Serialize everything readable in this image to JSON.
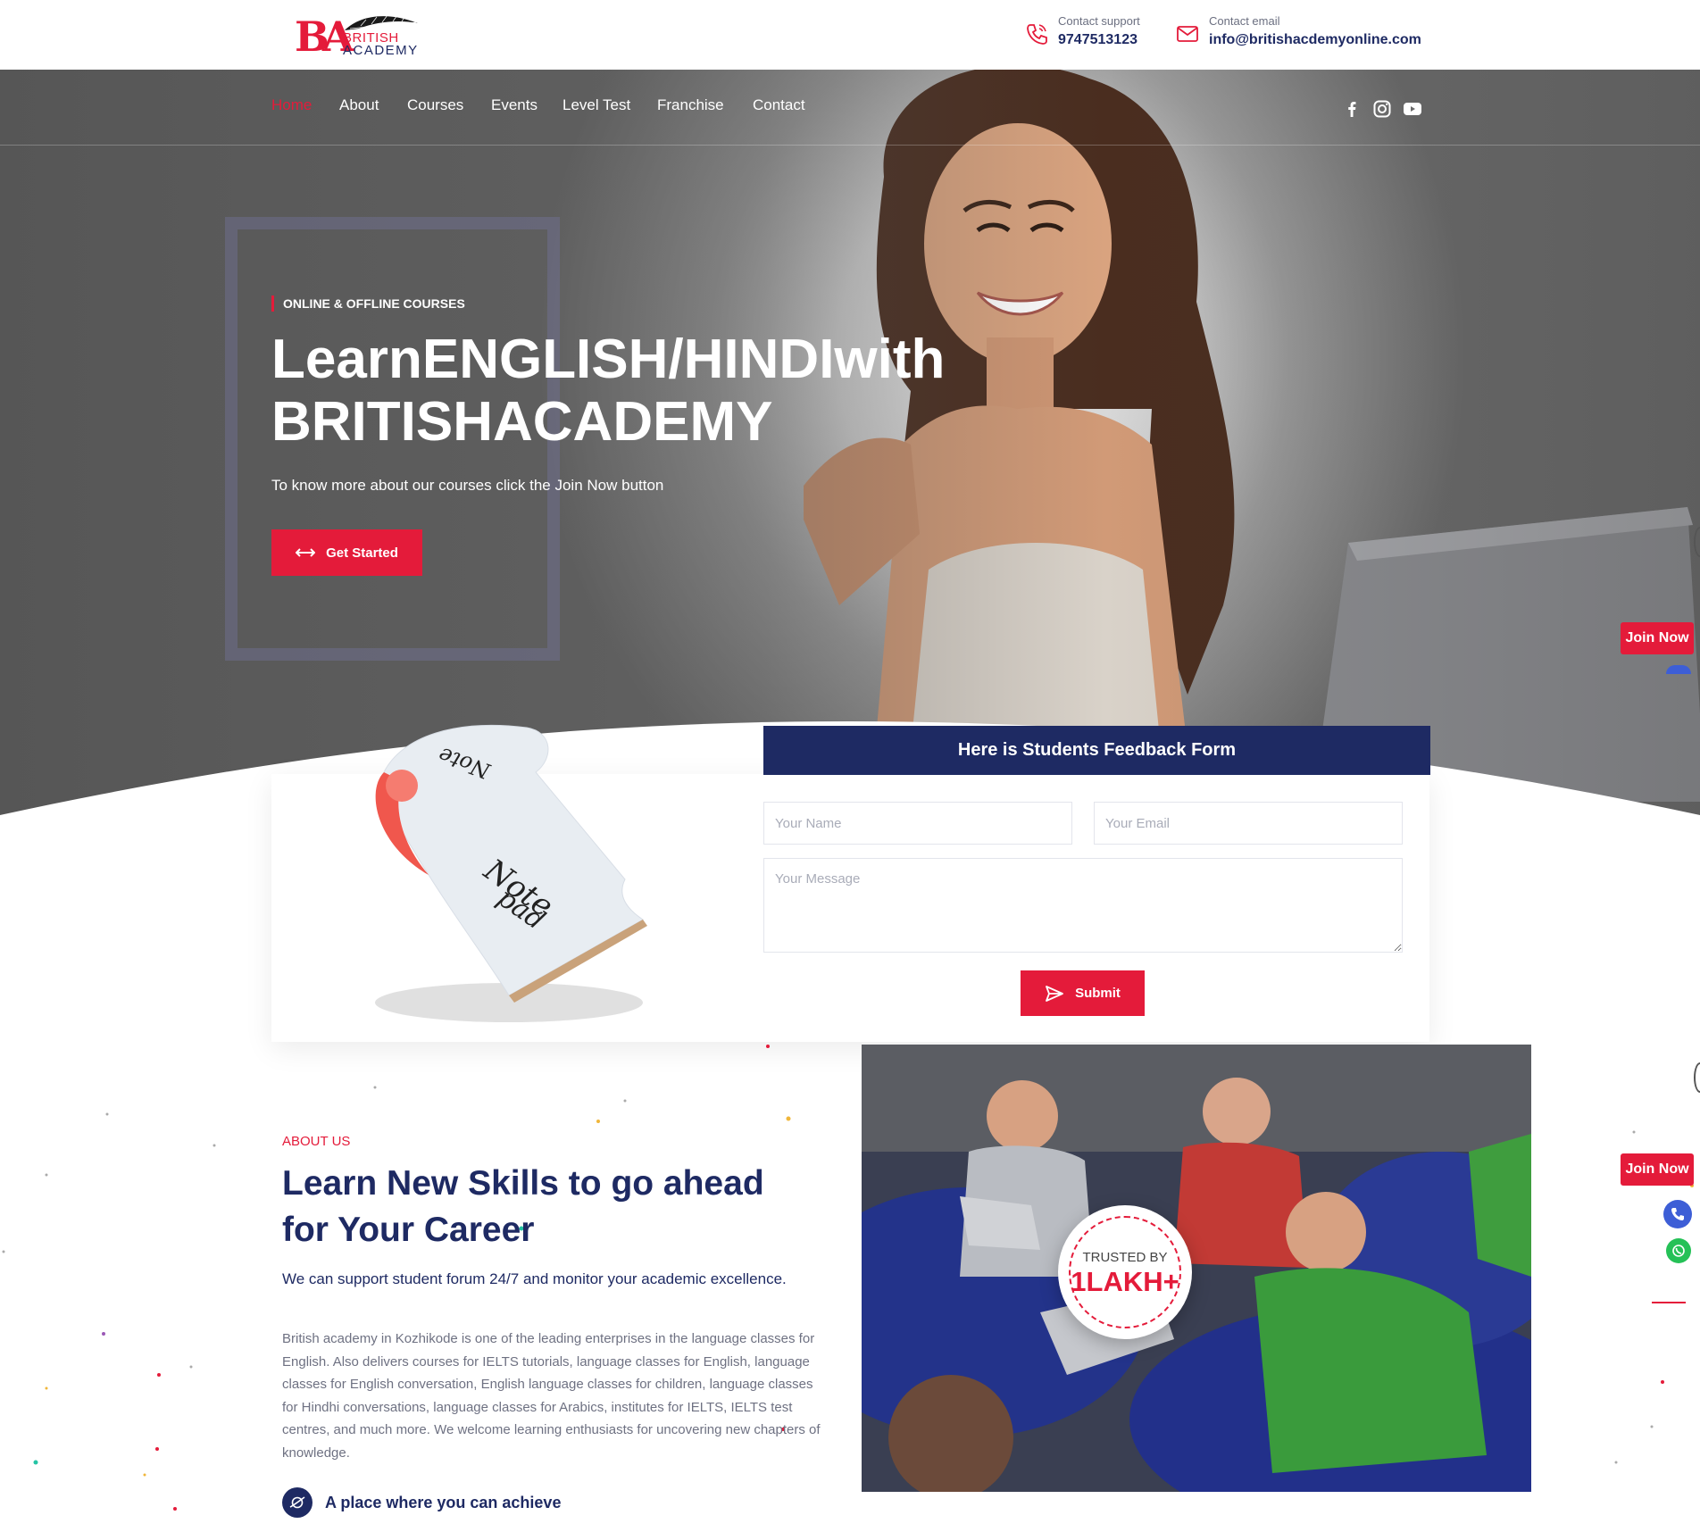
{
  "brand": {
    "logo_mark": "BA",
    "logo_line1": "BRITISH",
    "logo_line2": "ACADEMY",
    "red": "#e41b3a",
    "navy": "#1e2a63"
  },
  "contact": {
    "support_label": "Contact support",
    "support_value": "9747513123",
    "support_icon": "phone-icon",
    "email_label": "Contact email",
    "email_value": "info@britishacdemyonline.com",
    "email_icon": "mail-icon"
  },
  "nav": {
    "items": [
      {
        "label": "Home",
        "active": true
      },
      {
        "label": "About"
      },
      {
        "label": "Courses"
      },
      {
        "label": "Events"
      },
      {
        "label": "Level Test"
      },
      {
        "label": "Franchise"
      },
      {
        "label": "Contact"
      }
    ],
    "social": [
      "facebook-icon",
      "instagram-icon",
      "youtube-icon"
    ]
  },
  "hero": {
    "eyebrow": "ONLINE & OFFLINE COURSES",
    "title_line1": "LearnENGLISH/HINDIwith",
    "title_line2": "BRITISHACADEMY",
    "subtitle": "To know more about our courses click the Join Now button",
    "cta_label": "Get Started"
  },
  "side": {
    "join_label_1": "Join Now",
    "join_label_2": "Join Now"
  },
  "feedback": {
    "heading": "Here is Students Feedback Form",
    "name_placeholder": "Your Name",
    "email_placeholder": "Your Email",
    "message_placeholder": "Your Message",
    "submit_label": "Submit"
  },
  "about": {
    "tag": "ABOUT US",
    "title": "Learn New Skills to go ahead for Your Career",
    "lead": "We can support student forum 24/7 and monitor your academic excellence.",
    "body": "British academy in Kozhikode is one of the leading enterprises in the language classes for English. Also delivers courses for IELTS tutorials, language classes for English, language classes for English conversation, English language classes for children, language classes for Hindhi conversations, language classes for Arabics, institutes for IELTS, IELTS test centres, and much more. We welcome learning enthusiasts for uncovering new chapters of knowledge.",
    "feature": "A place where you can achieve",
    "trust_line1": "TRUSTED BY",
    "trust_line2": "1LAKH+"
  }
}
